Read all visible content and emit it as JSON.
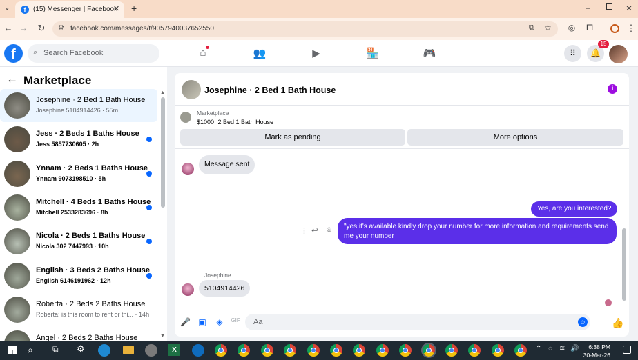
{
  "browser": {
    "tab_title": "(15) Messenger | Facebook",
    "url": "facebook.com/messages/t/9057940037652550"
  },
  "fb": {
    "search_placeholder": "Search Facebook",
    "notif_count": "15"
  },
  "sidebar": {
    "title": "Marketplace",
    "items": [
      {
        "name": "Josephine · 2 Bed 1 Bath House",
        "sub": "Josephine 5104914426 · 55m",
        "unread": false,
        "active": true
      },
      {
        "name": "Jess · 2 Beds 1 Baths House",
        "sub": "Jess 5857730605 · 2h",
        "unread": true
      },
      {
        "name": "Ynnam · 2 Beds 1 Baths House",
        "sub": "Ynnam 9073198510 · 5h",
        "unread": true
      },
      {
        "name": "Mitchell · 4 Beds 1 Baths House",
        "sub": "Mitchell 2533283696 · 8h",
        "unread": true
      },
      {
        "name": "Nicola · 2 Beds 1 Baths House",
        "sub": "Nicola 302 7447993 · 10h",
        "unread": true
      },
      {
        "name": "English · 3 Beds 2 Baths House",
        "sub": "English 6146191962 · 12h",
        "unread": true
      },
      {
        "name": "Roberta · 2 Beds 2 Baths House",
        "sub": "Roberta: is this room to rent or thi... · 14h",
        "unread": false
      },
      {
        "name": "Angel · 2 Beds 2 Baths House",
        "sub": "",
        "unread": false
      }
    ]
  },
  "chat": {
    "title": "Josephine · 2 Bed 1 Bath House",
    "listing": {
      "label": "Marketplace",
      "title": "$1000· 2 Bed 1 Bath House"
    },
    "mark_pending": "Mark as pending",
    "more_options": "More options",
    "messages": {
      "sent_notice": "Message sent",
      "out1": "Yes, are you interested?",
      "out2": "\"yes it's available kindly drop your number for more information and requirements send me your number",
      "sender": "Josephine",
      "in1": "5104914426"
    },
    "composer_placeholder": "Aa"
  },
  "taskbar": {
    "time": "6:38 PM",
    "date": "30-Mar-26"
  }
}
